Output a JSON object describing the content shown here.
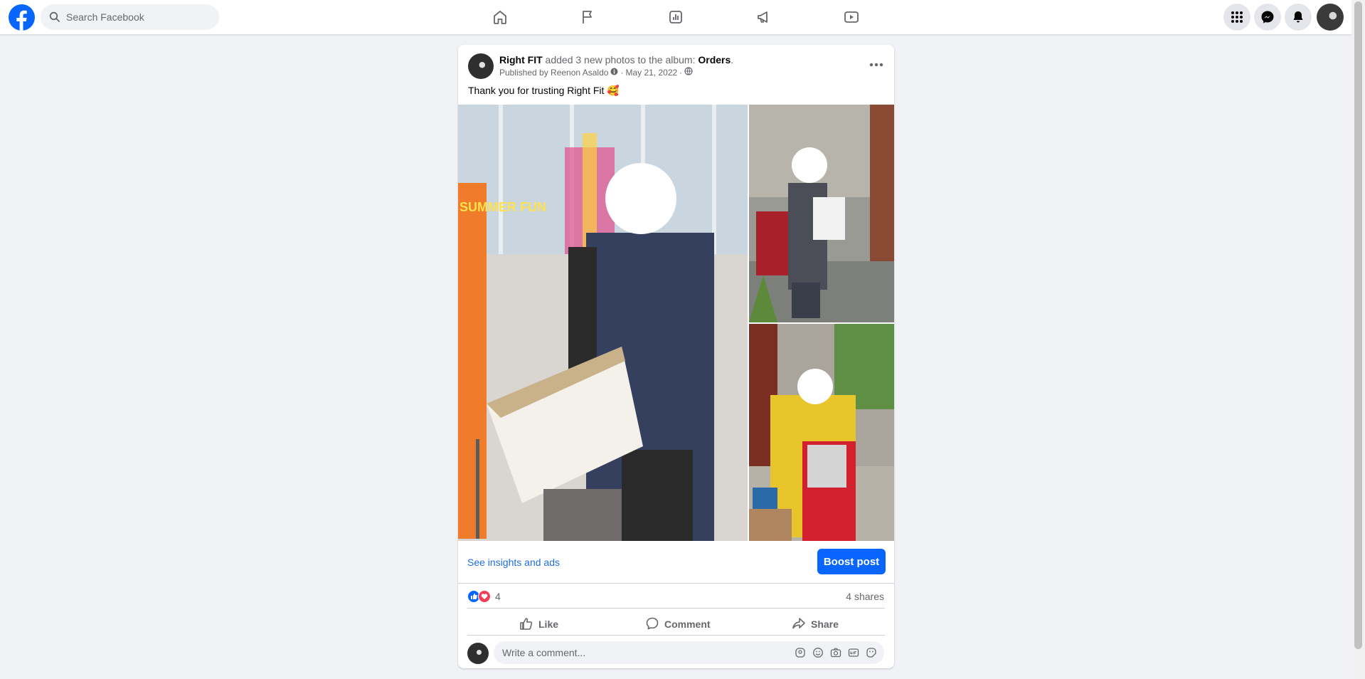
{
  "topbar": {
    "search_placeholder": "Search Facebook",
    "nav_icons": [
      "home-icon",
      "flag-icon",
      "insights-icon",
      "megaphone-icon",
      "video-icon"
    ],
    "right_icons": [
      "menu-grid-icon",
      "messenger-icon",
      "bell-icon"
    ]
  },
  "post": {
    "page_name": "Right FIT",
    "action_text": "added 3 new photos to the album:",
    "album_name": "Orders",
    "album_suffix": ".",
    "published_by": "Published by Reenon Asaldo",
    "date": "May 21, 2022",
    "separator": "·",
    "caption": "Thank you for trusting Right Fit 🥰",
    "photo_text": "SUMMER FUN",
    "insights_link": "See insights and ads",
    "boost_label": "Boost post",
    "reaction_count": "4",
    "shares": "4 shares",
    "actions": {
      "like": "Like",
      "comment": "Comment",
      "share": "Share"
    },
    "comment_placeholder": "Write a comment..."
  },
  "colors": {
    "brand": "#0866ff",
    "link": "#216fdb",
    "background": "#f0f2f5"
  }
}
